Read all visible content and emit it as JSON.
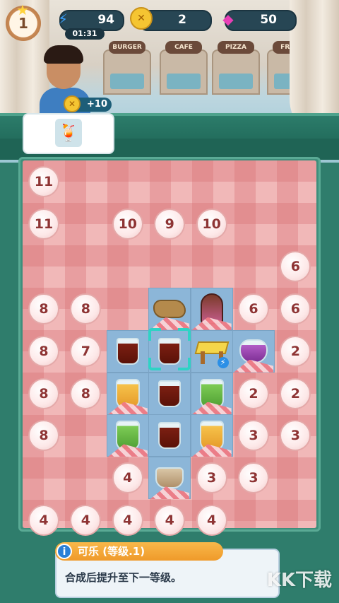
{
  "hud": {
    "level": "1",
    "energy": "94",
    "energy_timer": "01:31",
    "coins": "2",
    "gems": "50"
  },
  "scene": {
    "shops": [
      "BURGER",
      "CAFE",
      "PIZZA",
      "FRUIT"
    ]
  },
  "order": {
    "reward": "+10",
    "item_icon": "cocktail-icon"
  },
  "board": {
    "locked_cells": [
      {
        "row": 0,
        "col": 0,
        "level": "11"
      },
      {
        "row": 1,
        "col": 0,
        "level": "11"
      },
      {
        "row": 1,
        "col": 2,
        "level": "10"
      },
      {
        "row": 1,
        "col": 3,
        "level": "9"
      },
      {
        "row": 1,
        "col": 4,
        "level": "10"
      },
      {
        "row": 2,
        "col": 6,
        "level": "6"
      },
      {
        "row": 3,
        "col": 0,
        "level": "8"
      },
      {
        "row": 3,
        "col": 1,
        "level": "8"
      },
      {
        "row": 3,
        "col": 5,
        "level": "6"
      },
      {
        "row": 3,
        "col": 6,
        "level": "6"
      },
      {
        "row": 4,
        "col": 0,
        "level": "8"
      },
      {
        "row": 4,
        "col": 1,
        "level": "7"
      },
      {
        "row": 4,
        "col": 6,
        "level": "2"
      },
      {
        "row": 5,
        "col": 0,
        "level": "8"
      },
      {
        "row": 5,
        "col": 1,
        "level": "8"
      },
      {
        "row": 5,
        "col": 5,
        "level": "2"
      },
      {
        "row": 5,
        "col": 6,
        "level": "2"
      },
      {
        "row": 6,
        "col": 0,
        "level": "8"
      },
      {
        "row": 6,
        "col": 5,
        "level": "3"
      },
      {
        "row": 6,
        "col": 6,
        "level": "3"
      },
      {
        "row": 7,
        "col": 2,
        "level": "4"
      },
      {
        "row": 7,
        "col": 4,
        "level": "3"
      },
      {
        "row": 7,
        "col": 5,
        "level": "3"
      },
      {
        "row": 8,
        "col": 0,
        "level": "4"
      },
      {
        "row": 8,
        "col": 1,
        "level": "4"
      },
      {
        "row": 8,
        "col": 2,
        "level": "4"
      },
      {
        "row": 8,
        "col": 3,
        "level": "4"
      },
      {
        "row": 8,
        "col": 4,
        "level": "4"
      }
    ],
    "open_cells": [
      {
        "row": 3,
        "col": 3,
        "item": "fish-icon"
      },
      {
        "row": 3,
        "col": 4,
        "item": "popsicle-icon"
      },
      {
        "row": 4,
        "col": 2,
        "item": "cola-glass-icon"
      },
      {
        "row": 4,
        "col": 3,
        "item": "cola-glass-icon"
      },
      {
        "row": 4,
        "col": 4,
        "item": "table-icon"
      },
      {
        "row": 4,
        "col": 5,
        "item": "berry-drink-icon"
      },
      {
        "row": 5,
        "col": 2,
        "item": "lemonade-icon"
      },
      {
        "row": 5,
        "col": 3,
        "item": "cola-glass-icon"
      },
      {
        "row": 5,
        "col": 4,
        "item": "lime-drink-icon"
      },
      {
        "row": 6,
        "col": 2,
        "item": "lime-drink-icon"
      },
      {
        "row": 6,
        "col": 3,
        "item": "cola-glass-icon"
      },
      {
        "row": 6,
        "col": 4,
        "item": "lemonade-icon"
      },
      {
        "row": 7,
        "col": 3,
        "item": "tea-icon"
      }
    ]
  },
  "info": {
    "title": "可乐 (等级.1)",
    "description": "合成后提升至下一等级。"
  },
  "watermark": "KK下载"
}
